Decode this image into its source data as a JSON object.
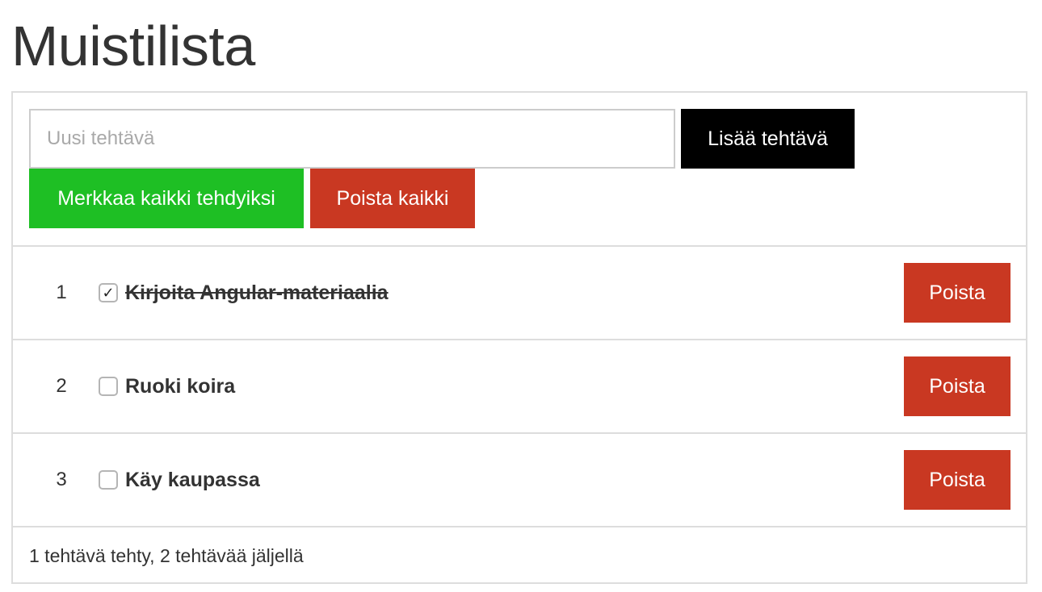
{
  "page": {
    "title": "Muistilista"
  },
  "add_form": {
    "placeholder": "Uusi tehtävä",
    "value": "",
    "add_label": "Lisää tehtävä",
    "mark_all_label": "Merkkaa kaikki tehdyiksi",
    "delete_all_label": "Poista kaikki"
  },
  "todos": [
    {
      "number": "1",
      "text": "Kirjoita Angular-materiaalia",
      "done": true,
      "checkmark": "✓",
      "delete_label": "Poista"
    },
    {
      "number": "2",
      "text": "Ruoki koira",
      "done": false,
      "checkmark": "",
      "delete_label": "Poista"
    },
    {
      "number": "3",
      "text": "Käy kaupassa",
      "done": false,
      "checkmark": "",
      "delete_label": "Poista"
    }
  ],
  "footer": {
    "status": "1 tehtävä tehty, 2 tehtävää jäljellä"
  },
  "colors": {
    "add_button": "#000000",
    "mark_all_button": "#1ebf24",
    "delete_button": "#c93822",
    "border": "#dddddd",
    "text": "#333333"
  }
}
